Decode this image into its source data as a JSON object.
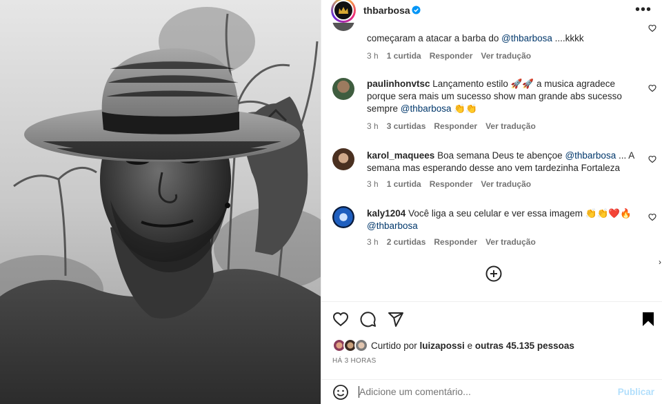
{
  "header": {
    "username": "thbarbosa",
    "more_icon": "more-horizontal-icon"
  },
  "comments": [
    {
      "text_parts": [
        "começaram a atacar a barba do ",
        "@thbarbosa",
        " ....kkkk"
      ],
      "time": "3 h",
      "likes": "1 curtida",
      "reply": "Responder",
      "translate": "Ver tradução"
    },
    {
      "user": "paulinhonvtsc",
      "text_1": " Lançamento estilo 🚀🚀 a musica agradece porque sera mais um sucesso show man grande abs sucesso sempre ",
      "mention": "@thbarbosa",
      "text_2": " 👏👏",
      "time": "3 h",
      "likes": "3 curtidas",
      "reply": "Responder",
      "translate": "Ver tradução"
    },
    {
      "user": "karol_maquees",
      "text_1": " Boa semana Deus te abençoe ",
      "mention": "@thbarbosa",
      "text_2": " ... A semana mas esperando desse ano vem tardezinha Fortaleza",
      "time": "3 h",
      "likes": "1 curtida",
      "reply": "Responder",
      "translate": "Ver tradução"
    },
    {
      "user": "kaly1204",
      "text_1": " Você liga a seu celular e ver essa imagem 👏👏❤️🔥 ",
      "mention": "@thbarbosa",
      "text_2": "",
      "time": "3 h",
      "likes": "2 curtidas",
      "reply": "Responder",
      "translate": "Ver tradução"
    }
  ],
  "likes": {
    "prefix": "Curtido por ",
    "user": "luizapossi",
    "middle": " e ",
    "others": "outras 45.135 pessoas"
  },
  "time_ago": "HÁ 3 HORAS",
  "add_comment": {
    "placeholder": "Adicione um comentário...",
    "publish": "Publicar"
  },
  "colors": {
    "mention": "#00376b",
    "meta": "#737373",
    "publish_disabled": "#b2dffc",
    "verified": "#0095f6"
  }
}
